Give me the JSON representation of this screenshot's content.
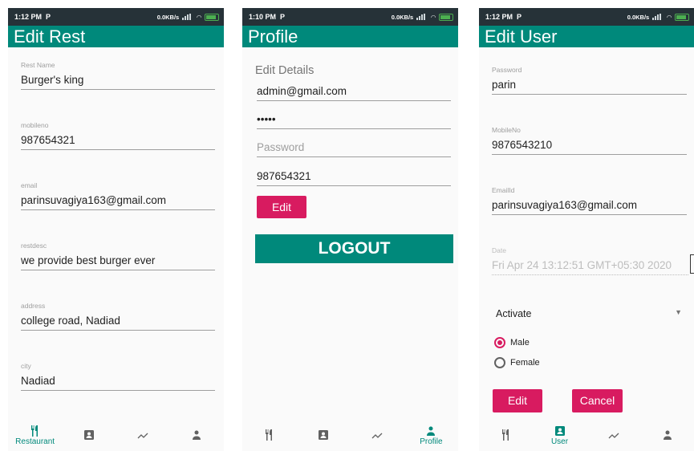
{
  "screens": {
    "edit_rest": {
      "status": {
        "time": "1:12 PM",
        "carrier_glyph": "P",
        "net": "0.0KB/s"
      },
      "title": "Edit Rest",
      "fields": [
        {
          "label": "Rest Name",
          "value": "Burger's king"
        },
        {
          "label": "mobileno",
          "value": "987654321"
        },
        {
          "label": "email",
          "value": "parinsuvagiya163@gmail.com"
        },
        {
          "label": "restdesc",
          "value": "we provide best burger ever"
        },
        {
          "label": "address",
          "value": "college road, Nadiad"
        },
        {
          "label": "city",
          "value": "Nadiad"
        }
      ],
      "nav": [
        {
          "label": "Restaurant"
        },
        {
          "label": ""
        },
        {
          "label": ""
        },
        {
          "label": ""
        }
      ]
    },
    "profile": {
      "status": {
        "time": "1:10 PM",
        "carrier_glyph": "P",
        "net": "0.0KB/s"
      },
      "title": "Profile",
      "section": "Edit Details",
      "email": "admin@gmail.com",
      "password_masked": "•••••",
      "password_placeholder": "Password",
      "phone": "987654321",
      "edit_label": "Edit",
      "logout_label": "LOGOUT",
      "nav": [
        {
          "label": ""
        },
        {
          "label": ""
        },
        {
          "label": ""
        },
        {
          "label": "Profile"
        }
      ]
    },
    "edit_user": {
      "status": {
        "time": "1:12 PM",
        "carrier_glyph": "P",
        "net": "0.0KB/s"
      },
      "title": "Edit User",
      "fields": [
        {
          "label": "Password",
          "value": "parin"
        },
        {
          "label": "MobileNo",
          "value": "9876543210"
        },
        {
          "label": "EmailId",
          "value": "parinsuvagiya163@gmail.com"
        },
        {
          "label": "Date",
          "value": "Fri Apr 24 13:12:51 GMT+05:30 2020"
        }
      ],
      "status_select": "Activate",
      "gender": {
        "options": [
          "Male",
          "Female"
        ],
        "selected": "Male"
      },
      "edit_label": "Edit",
      "cancel_label": "Cancel",
      "nav": [
        {
          "label": ""
        },
        {
          "label": "User"
        },
        {
          "label": ""
        },
        {
          "label": ""
        }
      ]
    }
  },
  "colors": {
    "primary": "#00897b",
    "accent": "#d81b60",
    "statusbar": "#263238"
  },
  "icons": [
    "restaurant-icon",
    "contact-card-icon",
    "trending-icon",
    "person-icon"
  ]
}
